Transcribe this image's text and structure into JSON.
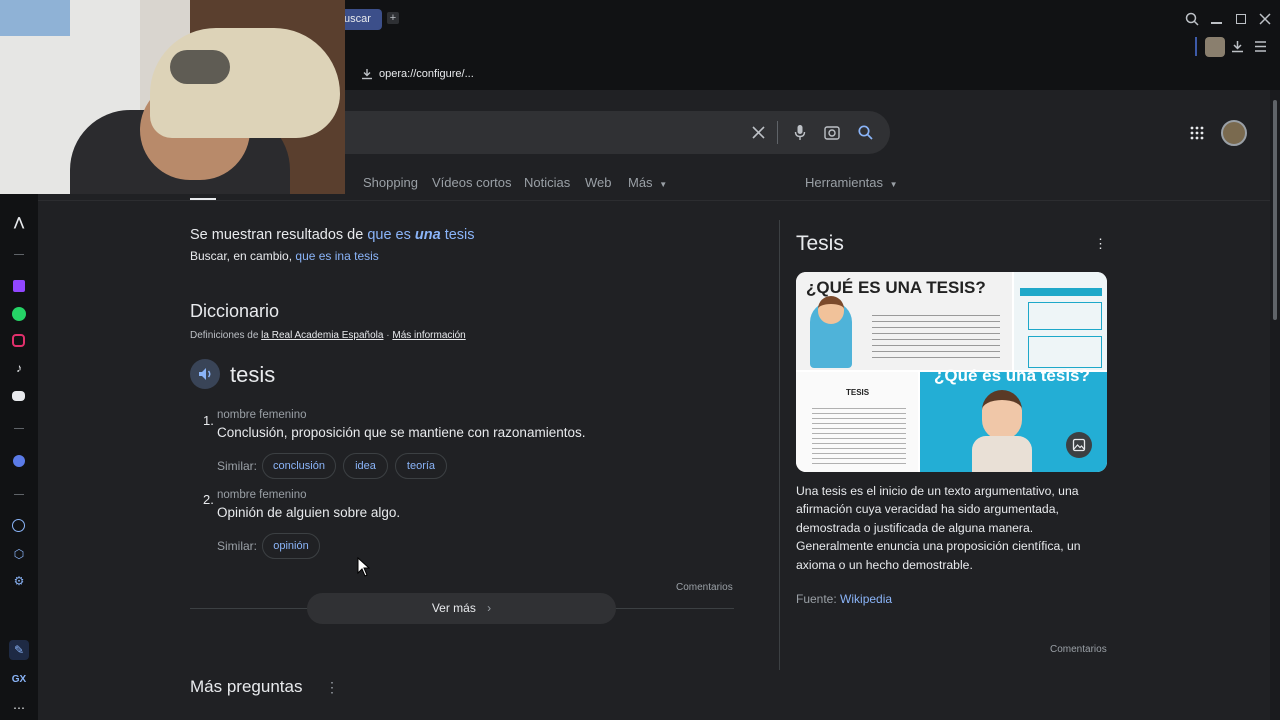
{
  "browser": {
    "tab_label": "uscar",
    "address": "opera://configure/..."
  },
  "search": {
    "clear_icon": "close-icon",
    "mic_icon": "mic-icon",
    "lens_icon": "camera-icon",
    "search_icon": "search-icon"
  },
  "nav": {
    "tabs": [
      "Shopping",
      "Vídeos cortos",
      "Noticias",
      "Web",
      "Más"
    ],
    "tools": "Herramientas"
  },
  "correction": {
    "showing_prefix": "Se muestran resultados de",
    "showing_part1": "que es",
    "showing_part2": "una",
    "showing_part3": "tesis",
    "instead_prefix": "Buscar, en cambio,",
    "instead_link": "que es ina tesis"
  },
  "dictionary": {
    "heading": "Diccionario",
    "source_prefix": "Definiciones de",
    "source_link": "la Real Academia Española",
    "separator": "·",
    "more_info": "Más información",
    "word": "tesis",
    "senses": [
      {
        "num": "1.",
        "type": "nombre femenino",
        "definition": "Conclusión, proposición que se mantiene con razonamientos.",
        "similar_label": "Similar:",
        "chips": [
          "conclusión",
          "idea",
          "teoría"
        ]
      },
      {
        "num": "2.",
        "type": "nombre femenino",
        "definition": "Opinión de alguien sobre algo.",
        "similar_label": "Similar:",
        "chips": [
          "opinión"
        ]
      }
    ],
    "feedback": "Comentarios",
    "see_more": "Ver más"
  },
  "more_questions": "Más preguntas",
  "knowledge_panel": {
    "title": "Tesis",
    "image_heading_1": "¿QUÉ ES UNA TESIS?",
    "image_heading_2": "¿Qué es una tesis?",
    "image_small_title": "TESIS",
    "description": "Una tesis es el inicio de un texto argumentativo, una afirmación cuya veracidad ha sido argumentada, demostrada o justificada de alguna manera. Generalmente enuncia una proposición científica, un axioma o un hecho demostrable.",
    "source_label": "Fuente:",
    "source_link": "Wikipedia",
    "feedback": "Comentarios"
  },
  "colors": {
    "background": "#202124",
    "link": "#8ab4f8",
    "accent_orange": "#e8710a"
  }
}
